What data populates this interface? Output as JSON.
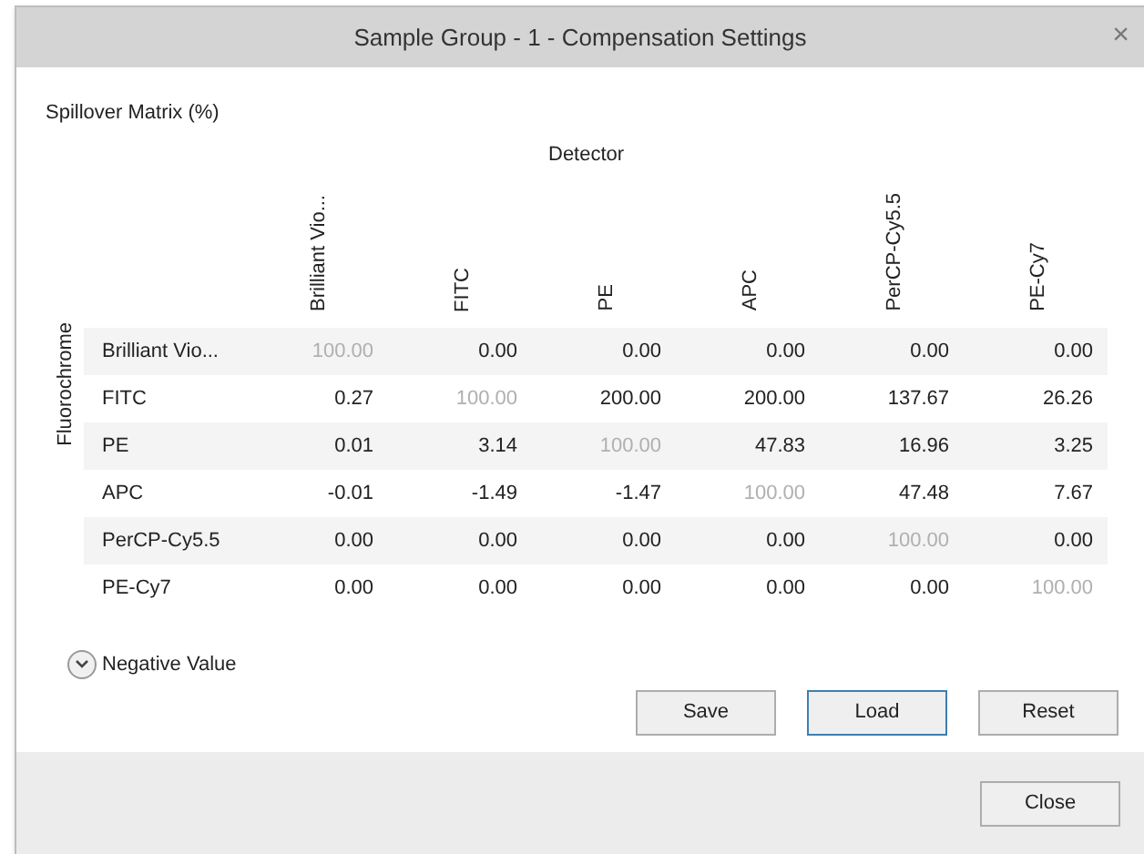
{
  "window": {
    "title": "Sample Group - 1 - Compensation Settings",
    "close": "×"
  },
  "matrix": {
    "title": "Spillover Matrix (%)",
    "column_axis": "Detector",
    "row_axis": "Fluorochrome",
    "columns": [
      "Brilliant Vio...",
      "FITC",
      "PE",
      "APC",
      "PerCP-Cy5.5",
      "PE-Cy7"
    ],
    "rows": [
      {
        "label": "Brilliant Vio...",
        "cells": [
          {
            "text": "100.00",
            "dim": true
          },
          {
            "text": "0.00",
            "dim": false
          },
          {
            "text": "0.00",
            "dim": false
          },
          {
            "text": "0.00",
            "dim": false
          },
          {
            "text": "0.00",
            "dim": false
          },
          {
            "text": "0.00",
            "dim": false
          }
        ]
      },
      {
        "label": "FITC",
        "cells": [
          {
            "text": "0.27",
            "dim": false
          },
          {
            "text": "100.00",
            "dim": true
          },
          {
            "text": "200.00",
            "dim": false
          },
          {
            "text": "200.00",
            "dim": false
          },
          {
            "text": "137.67",
            "dim": false
          },
          {
            "text": "26.26",
            "dim": false
          }
        ]
      },
      {
        "label": "PE",
        "cells": [
          {
            "text": "0.01",
            "dim": false
          },
          {
            "text": "3.14",
            "dim": false
          },
          {
            "text": "100.00",
            "dim": true
          },
          {
            "text": "47.83",
            "dim": false
          },
          {
            "text": "16.96",
            "dim": false
          },
          {
            "text": "3.25",
            "dim": false
          }
        ]
      },
      {
        "label": "APC",
        "cells": [
          {
            "text": "-0.01",
            "dim": false
          },
          {
            "text": "-1.49",
            "dim": false
          },
          {
            "text": "-1.47",
            "dim": false
          },
          {
            "text": "100.00",
            "dim": true
          },
          {
            "text": "47.48",
            "dim": false
          },
          {
            "text": "7.67",
            "dim": false
          }
        ]
      },
      {
        "label": "PerCP-Cy5.5",
        "cells": [
          {
            "text": "0.00",
            "dim": false
          },
          {
            "text": "0.00",
            "dim": false
          },
          {
            "text": "0.00",
            "dim": false
          },
          {
            "text": "0.00",
            "dim": false
          },
          {
            "text": "100.00",
            "dim": true
          },
          {
            "text": "0.00",
            "dim": false
          }
        ]
      },
      {
        "label": "PE-Cy7",
        "cells": [
          {
            "text": "0.00",
            "dim": false
          },
          {
            "text": "0.00",
            "dim": false
          },
          {
            "text": "0.00",
            "dim": false
          },
          {
            "text": "0.00",
            "dim": false
          },
          {
            "text": "0.00",
            "dim": false
          },
          {
            "text": "100.00",
            "dim": true
          }
        ]
      }
    ]
  },
  "expander": {
    "label": "Negative Value",
    "expanded": false
  },
  "buttons": [
    {
      "label": "Save",
      "focused": false
    },
    {
      "label": "Load",
      "focused": true
    },
    {
      "label": "Reset",
      "focused": false
    }
  ],
  "footer_buttons": [
    {
      "label": "Close",
      "focused": false
    }
  ]
}
